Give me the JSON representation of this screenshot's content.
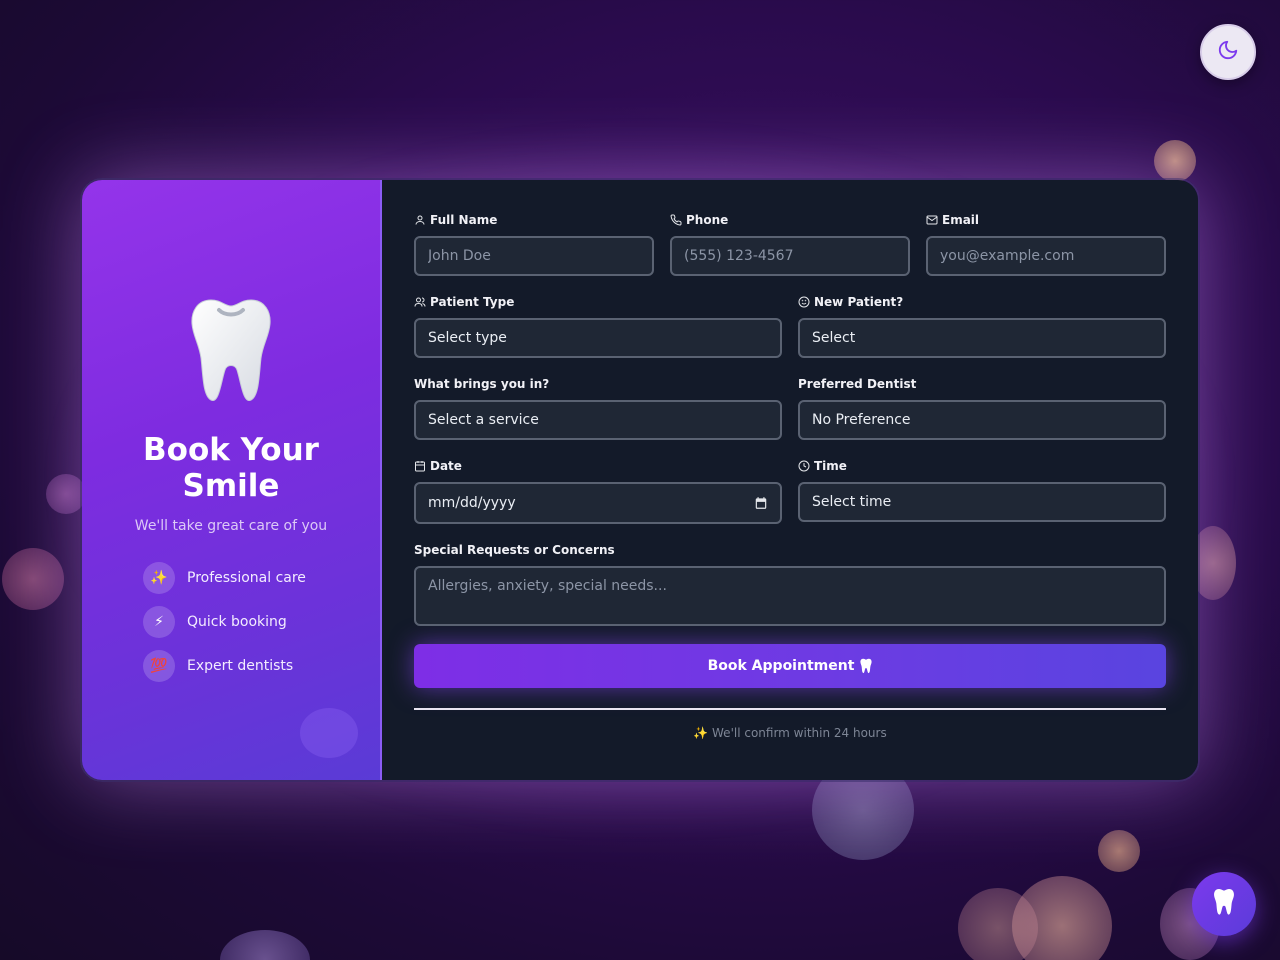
{
  "theme_toggle": {
    "icon": "moon-icon"
  },
  "sidebar": {
    "icon": "tooth-icon",
    "title": "Book Your Smile",
    "tagline": "We'll take great care of you",
    "features": [
      {
        "icon": "sparkles-icon",
        "glyph": "✨",
        "label": "Professional care"
      },
      {
        "icon": "lightning-icon",
        "glyph": "⚡",
        "label": "Quick booking"
      },
      {
        "icon": "hundred-icon",
        "glyph": "💯",
        "label": "Expert dentists"
      }
    ]
  },
  "form": {
    "full_name": {
      "label": "Full Name",
      "placeholder": "John Doe"
    },
    "phone": {
      "label": "Phone",
      "placeholder": "(555) 123-4567"
    },
    "email": {
      "label": "Email",
      "placeholder": "you@example.com"
    },
    "patient_type": {
      "label": "Patient Type",
      "value": "Select type"
    },
    "new_patient": {
      "label": "New Patient?",
      "value": "Select"
    },
    "service": {
      "label": "What brings you in?",
      "value": "Select a service"
    },
    "dentist": {
      "label": "Preferred Dentist",
      "value": "No Preference"
    },
    "date": {
      "label": "Date",
      "value": "mm/dd/yyyy"
    },
    "time": {
      "label": "Time",
      "value": "Select time"
    },
    "requests": {
      "label": "Special Requests or Concerns",
      "placeholder": "Allergies, anxiety, special needs..."
    },
    "submit_label": "Book Appointment",
    "footnote": "✨ We'll confirm within 24 hours"
  },
  "colors": {
    "accent": "#7c3aed",
    "sidebar_start": "#9434ea",
    "sidebar_end": "#5a3bd6",
    "panel_bg": "#131a29"
  }
}
